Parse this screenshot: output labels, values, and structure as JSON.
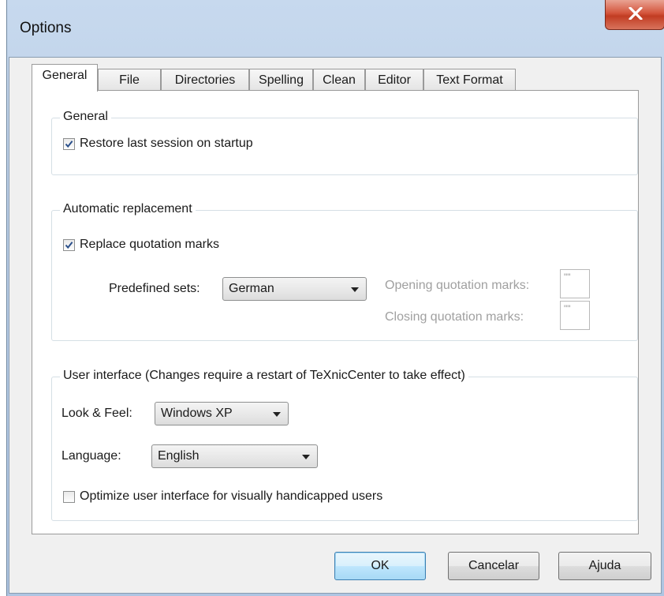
{
  "window": {
    "title": "Options",
    "close_glyph": "X",
    "close_icon": "close-icon"
  },
  "tabs": [
    {
      "label": "General",
      "active": true
    },
    {
      "label": "File",
      "active": false
    },
    {
      "label": "Directories",
      "active": false
    },
    {
      "label": "Spelling",
      "active": false
    },
    {
      "label": "Clean",
      "active": false
    },
    {
      "label": "Editor",
      "active": false
    },
    {
      "label": "Text Format",
      "active": false
    }
  ],
  "general_group": {
    "label": "General",
    "restore_session": {
      "label": "Restore last session on startup",
      "checked": true
    }
  },
  "replacement_group": {
    "label": "Automatic replacement",
    "replace_quotes": {
      "label": "Replace quotation marks",
      "checked": true
    },
    "predefined_label": "Predefined sets:",
    "predefined_value": "German",
    "opening_label": "Opening quotation marks:",
    "opening_value": "\"\"",
    "closing_label": "Closing quotation marks:",
    "closing_value": "\"\""
  },
  "ui_group": {
    "label": "User interface (Changes require a restart of TeXnicCenter to take effect)",
    "look_label": "Look & Feel:",
    "look_value": "Windows XP",
    "language_label": "Language:",
    "language_value": "English",
    "optimize": {
      "label": "Optimize user interface for visually handicapped users",
      "checked": false
    }
  },
  "buttons": {
    "ok": "OK",
    "cancel": "Cancelar",
    "help": "Ajuda"
  },
  "colors": {
    "frame": "#b9cde6",
    "close_button": "#c94a31",
    "default_button_border": "#3c7fb1"
  }
}
